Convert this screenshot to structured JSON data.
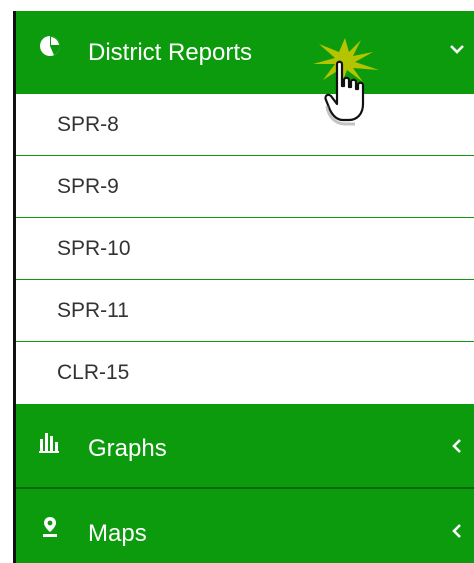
{
  "menu": {
    "district_reports": {
      "label": "District Reports",
      "icon": "pie-chart-icon",
      "chevron": "chevron-down-icon",
      "expanded": true,
      "items": [
        {
          "label": "SPR-8"
        },
        {
          "label": "SPR-9"
        },
        {
          "label": "SPR-10"
        },
        {
          "label": "SPR-11"
        },
        {
          "label": "CLR-15"
        }
      ]
    },
    "graphs": {
      "label": "Graphs",
      "icon": "bar-chart-icon",
      "chevron": "chevron-left-icon",
      "expanded": false
    },
    "maps": {
      "label": "Maps",
      "icon": "map-marker-icon",
      "chevron": "chevron-left-icon",
      "expanded": false
    }
  },
  "colors": {
    "header_green": "#0c9b0c",
    "divider_green": "#066906",
    "item_text": "#333333",
    "click_highlight": "#c8c800"
  },
  "cursor": {
    "icon": "hand-pointer-cursor-icon"
  }
}
